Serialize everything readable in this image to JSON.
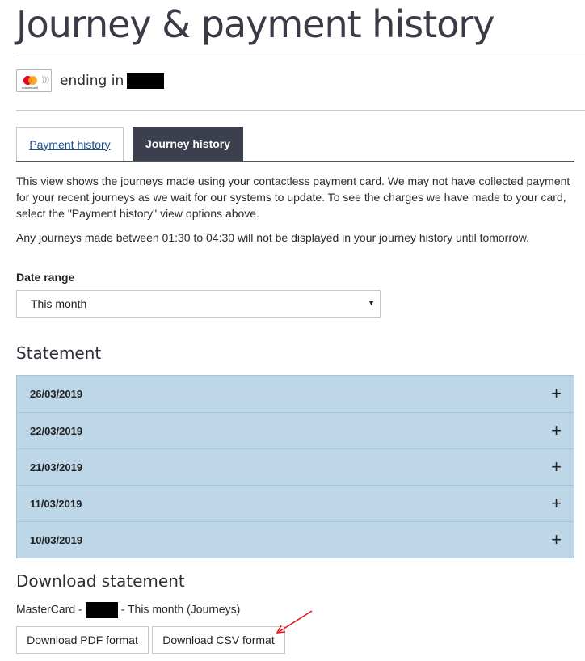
{
  "page": {
    "title": "Journey & payment history"
  },
  "card": {
    "brand_icon": "mastercard-icon",
    "label": "ending in"
  },
  "tabs": {
    "payment_history": "Payment history",
    "journey_history": "Journey history",
    "active": "Journey history"
  },
  "intro_text": "This view shows the journeys made using your contactless payment card. We may not have collected payment for your recent journeys as we wait for our systems to update. To see the charges we have made to your card, select the \"Payment history\" view options above.",
  "note_text": "Any journeys made between 01:30 to 04:30 will not be displayed in your journey history until tomorrow.",
  "date_range": {
    "label": "Date range",
    "selected": "This month"
  },
  "statement": {
    "heading": "Statement",
    "rows": [
      {
        "date": "26/03/2019"
      },
      {
        "date": "22/03/2019"
      },
      {
        "date": "21/03/2019"
      },
      {
        "date": "11/03/2019"
      },
      {
        "date": "10/03/2019"
      }
    ]
  },
  "download": {
    "heading": "Download statement",
    "caption_prefix": "MasterCard -",
    "caption_suffix": "- This month (Journeys)",
    "pdf_label": "Download PDF format",
    "csv_label": "Download CSV format"
  },
  "colors": {
    "tab_active_bg": "#3b3f4e",
    "statement_bg": "#bdd7e9",
    "link": "#1a4e8a",
    "annotation_arrow": "#e3111b"
  }
}
